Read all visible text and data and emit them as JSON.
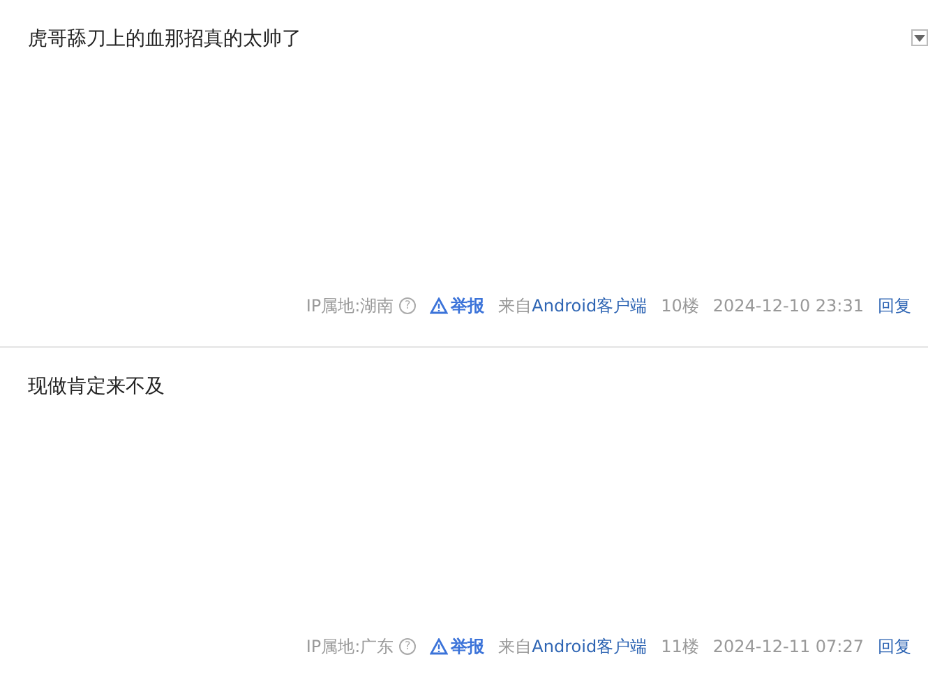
{
  "posts": [
    {
      "content": "虎哥舔刀上的血那招真的太帅了",
      "has_menu": true,
      "ip_location": "IP属地:湖南",
      "help_mark": "?",
      "report": "举报",
      "source_prefix": "来自",
      "source_link": "Android客户端",
      "floor": "10楼",
      "time": "2024-12-10 23:31",
      "reply": "回复"
    },
    {
      "content": "现做肯定来不及",
      "has_menu": false,
      "ip_location": "IP属地:广东",
      "help_mark": "?",
      "report": "举报",
      "source_prefix": "来自",
      "source_link": "Android客户端",
      "floor": "11楼",
      "time": "2024-12-11 07:27",
      "reply": "回复"
    }
  ]
}
